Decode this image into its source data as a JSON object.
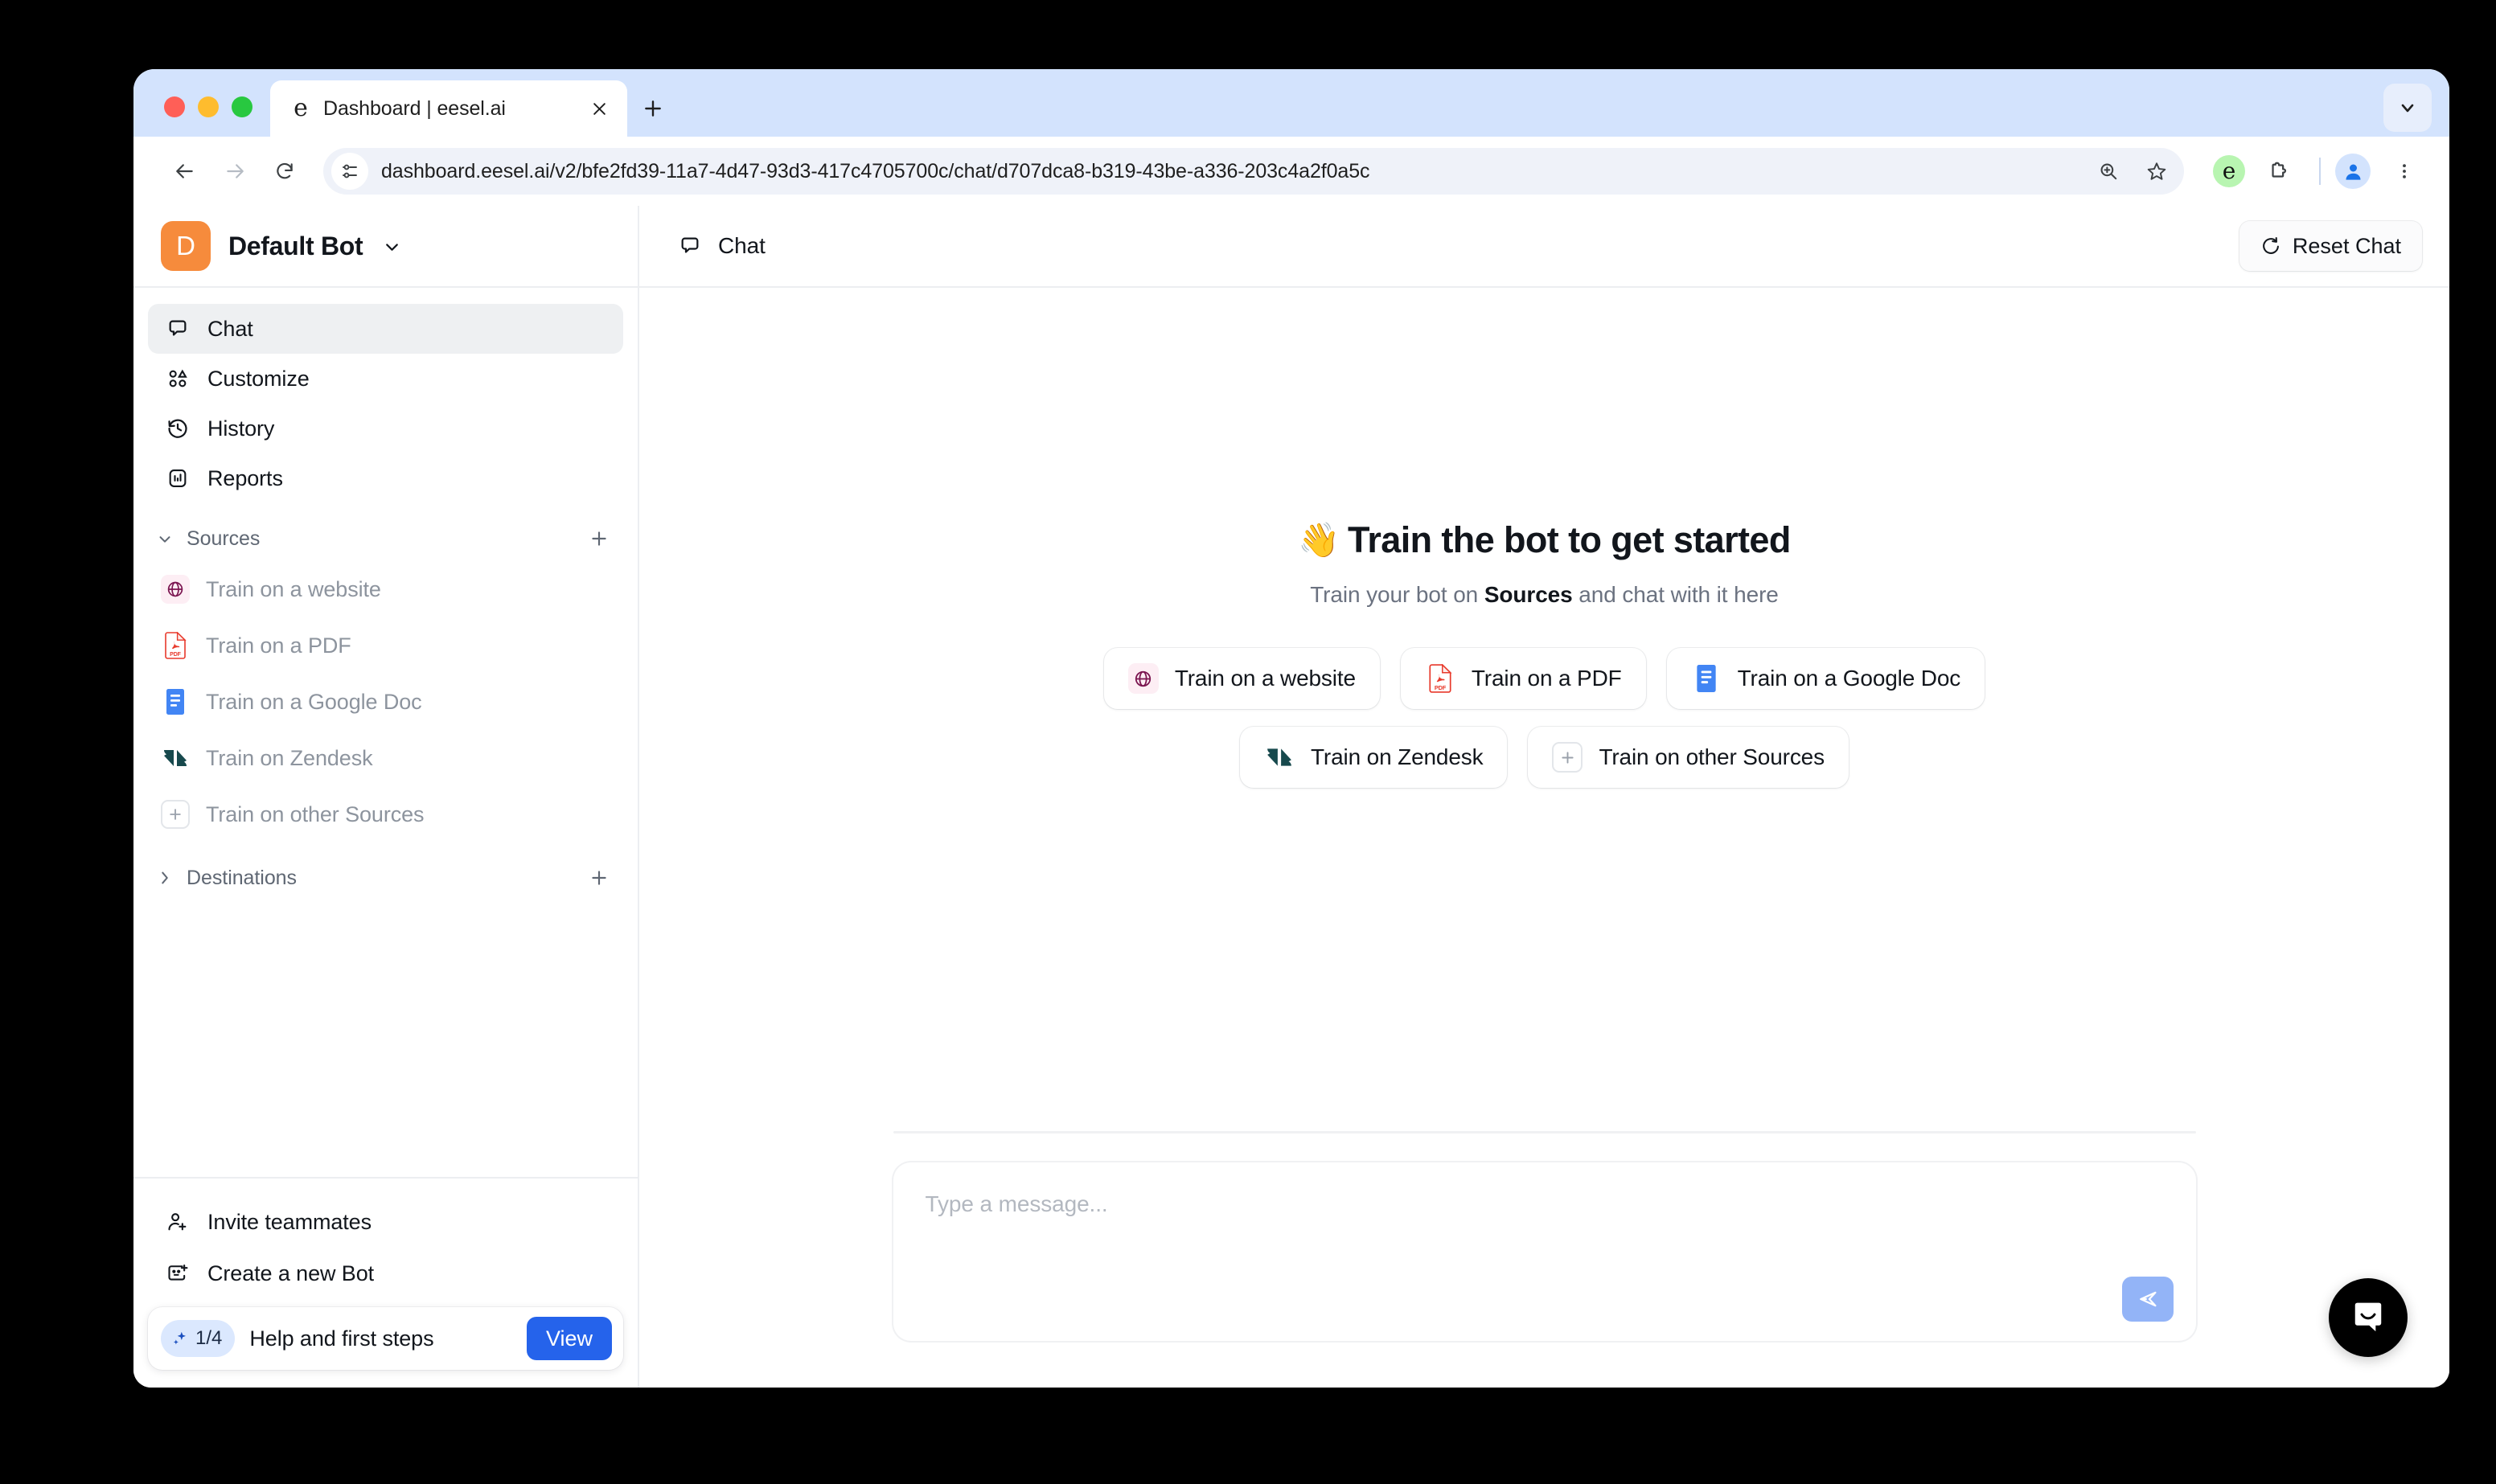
{
  "browser": {
    "tab": {
      "title": "Dashboard | eesel.ai",
      "favicon_text": "e",
      "favicon_name": "eesel-favicon"
    },
    "new_tab_name": "new-tab-button",
    "url": "dashboard.eesel.ai/v2/bfe2fd39-11a7-4d47-93d3-417c4705700c/chat/d707dca8-b319-43be-a336-203c4a2f0a5c",
    "toolbar": {
      "back_icon": "back-arrow-icon",
      "forward_icon": "forward-arrow-icon",
      "reload_icon": "reload-icon",
      "site_info_icon": "site-settings-icon",
      "zoom_icon": "zoom-in-icon",
      "bookmark_icon": "star-icon",
      "extension_eesel_text": "e",
      "extensions_icon": "extensions-puzzle-icon",
      "profile_icon": "profile-avatar-icon",
      "menu_icon": "three-dot-menu-icon",
      "tabstrip_chevron_icon": "chevron-down-icon"
    },
    "colors": {
      "tabstrip_bg": "#d3e3fd",
      "omnibox_bg": "#eff2f9"
    }
  },
  "sidebar": {
    "bot": {
      "avatar_letter": "D",
      "avatar_color": "#f68b3c",
      "name": "Default Bot",
      "chevron_icon": "chevron-down-icon"
    },
    "nav_items": [
      {
        "label": "Chat",
        "icon": "chat-bubble-icon",
        "active": true
      },
      {
        "label": "Customize",
        "icon": "shapes-icon",
        "active": false
      },
      {
        "label": "History",
        "icon": "clock-rewind-icon",
        "active": false
      },
      {
        "label": "Reports",
        "icon": "bar-chart-icon",
        "active": false
      }
    ],
    "sources_group": {
      "title": "Sources",
      "expanded": true,
      "chevron_icon": "chevron-down-icon",
      "add_icon": "plus-icon",
      "items": [
        {
          "label": "Train on a website",
          "icon": "globe-icon"
        },
        {
          "label": "Train on a PDF",
          "icon": "pdf-file-icon"
        },
        {
          "label": "Train on a Google Doc",
          "icon": "google-docs-icon"
        },
        {
          "label": "Train on Zendesk",
          "icon": "zendesk-icon"
        },
        {
          "label": "Train on other Sources",
          "icon": "plus-box-icon"
        }
      ]
    },
    "destinations_group": {
      "title": "Destinations",
      "expanded": false,
      "chevron_icon": "chevron-right-icon",
      "add_icon": "plus-icon"
    },
    "footer_items": [
      {
        "label": "Invite teammates",
        "icon": "user-plus-icon"
      },
      {
        "label": "Create a new Bot",
        "icon": "bot-plus-icon"
      }
    ],
    "help_card": {
      "progress": "1/4",
      "badge_icon": "sparkles-icon",
      "label": "Help and first steps",
      "button_label": "View",
      "button_color": "#2563eb"
    }
  },
  "main": {
    "header": {
      "title": "Chat",
      "icon": "chat-bubble-icon",
      "reset_button_label": "Reset Chat",
      "reset_button_icon": "refresh-icon"
    },
    "empty_state": {
      "emoji": "👋",
      "title": "Train the bot to get started",
      "subtitle_prefix": "Train your bot on ",
      "subtitle_bold": "Sources",
      "subtitle_suffix": " and chat with it here",
      "suggestions_row1": [
        {
          "label": "Train on a website",
          "icon": "globe-icon"
        },
        {
          "label": "Train on a PDF",
          "icon": "pdf-file-icon"
        },
        {
          "label": "Train on a Google Doc",
          "icon": "google-docs-icon"
        }
      ],
      "suggestions_row2": [
        {
          "label": "Train on Zendesk",
          "icon": "zendesk-icon"
        },
        {
          "label": "Train on other Sources",
          "icon": "plus-box-icon"
        }
      ]
    },
    "composer": {
      "placeholder": "Type a message...",
      "send_icon": "send-paper-plane-icon",
      "send_color": "#93b4f7"
    },
    "intercom": {
      "icon": "intercom-chat-icon",
      "color": "#000000"
    }
  }
}
